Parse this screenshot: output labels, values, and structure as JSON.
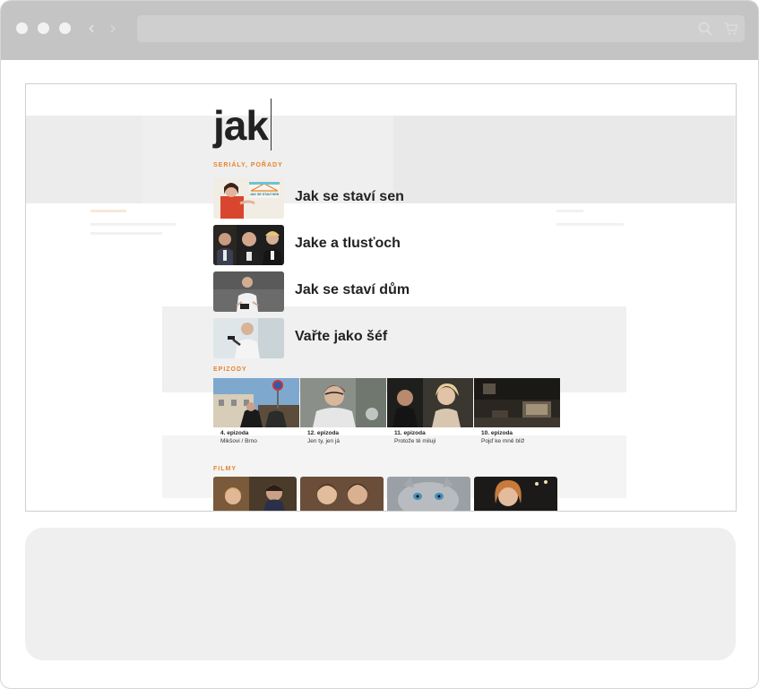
{
  "search": {
    "query": "jak"
  },
  "sections": {
    "shows_label": "SERIÁLY, POŘADY",
    "episodes_label": "EPIZODY",
    "films_label": "FILMY"
  },
  "shows": [
    {
      "title": "Jak se staví sen",
      "thumb_text": "JAK SE STAVÍ SEN"
    },
    {
      "title": "Jake a tlusťoch"
    },
    {
      "title": "Jak se staví dům"
    },
    {
      "title": "Vařte jako šéf"
    }
  ],
  "episodes": [
    {
      "number": "4. epizoda",
      "name": "Mikšovi / Brno"
    },
    {
      "number": "12. epizoda",
      "name": "Jen ty, jen já"
    },
    {
      "number": "11. epizoda",
      "name": "Protože tě miluji"
    },
    {
      "number": "10. epizoda",
      "name": "Pojď ke mně blíž"
    }
  ],
  "colors": {
    "accent": "#e8832a",
    "chrome": "#c4c4c4"
  },
  "icons": {
    "back": "chevron-left-icon",
    "forward": "chevron-right-icon",
    "search": "search-icon",
    "cart": "cart-icon"
  }
}
